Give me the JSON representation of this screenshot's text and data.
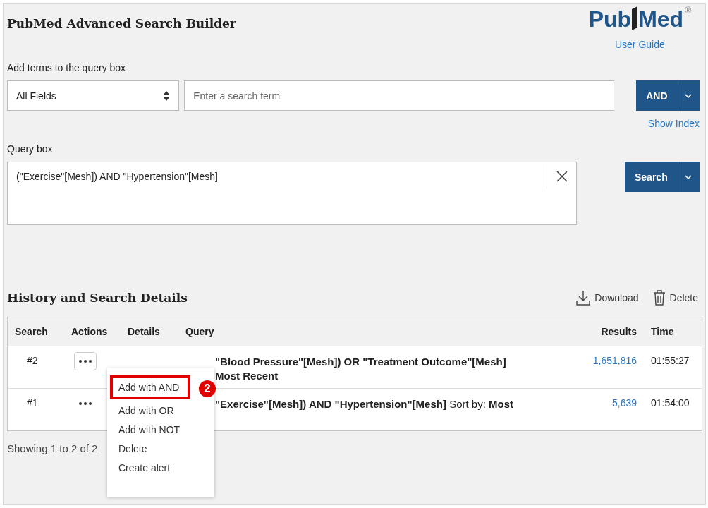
{
  "header": {
    "title": "PubMed Advanced Search Builder",
    "logo": {
      "left": "Pub",
      "right": "Med",
      "mark": "®"
    },
    "user_guide": "User Guide"
  },
  "builder": {
    "label": "Add terms to the query box",
    "field_select": "All Fields",
    "term_input": {
      "placeholder": "Enter a search term"
    },
    "operator_button": "AND",
    "show_index": "Show Index"
  },
  "query_box": {
    "label": "Query box",
    "value": "(\"Exercise\"[Mesh]) AND \"Hypertension\"[Mesh]",
    "search_button": "Search"
  },
  "history": {
    "title": "History and Search Details",
    "download": "Download",
    "delete": "Delete",
    "columns": [
      "Search",
      "Actions",
      "Details",
      "Query",
      "Results",
      "Time"
    ],
    "rows": [
      {
        "search": "#2",
        "actions_open": true,
        "query": "**\"Blood Pressure\"[Mesh]) OR \"Treatment Outcome\"[Mesh]**",
        "query_line_2": "Most Recent",
        "results": "1,651,816",
        "time": "01:55:27"
      },
      {
        "search": "#1",
        "actions_open": false,
        "query": "**\"Exercise\"[Mesh]) AND \"Hypertension\"[Mesh]** Sort by: **Most**",
        "results": "5,639",
        "time": "01:54:00"
      }
    ],
    "showing": "Showing 1 to 2 of 2"
  },
  "actions_menu": {
    "items": [
      {
        "label": "Add with AND",
        "highlighted": true
      },
      {
        "label": "Add with OR",
        "highlighted": false
      },
      {
        "label": "Add with NOT",
        "highlighted": false
      },
      {
        "label": "Delete",
        "highlighted": false
      },
      {
        "label": "Create alert",
        "highlighted": false
      }
    ],
    "annotation": "2"
  }
}
